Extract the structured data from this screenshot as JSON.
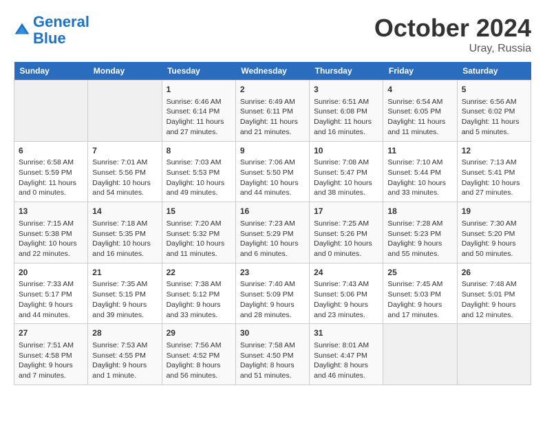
{
  "header": {
    "logo_line1": "General",
    "logo_line2": "Blue",
    "month": "October 2024",
    "location": "Uray, Russia"
  },
  "weekdays": [
    "Sunday",
    "Monday",
    "Tuesday",
    "Wednesday",
    "Thursday",
    "Friday",
    "Saturday"
  ],
  "weeks": [
    [
      {
        "day": "",
        "info": ""
      },
      {
        "day": "",
        "info": ""
      },
      {
        "day": "1",
        "info": "Sunrise: 6:46 AM\nSunset: 6:14 PM\nDaylight: 11 hours and 27 minutes."
      },
      {
        "day": "2",
        "info": "Sunrise: 6:49 AM\nSunset: 6:11 PM\nDaylight: 11 hours and 21 minutes."
      },
      {
        "day": "3",
        "info": "Sunrise: 6:51 AM\nSunset: 6:08 PM\nDaylight: 11 hours and 16 minutes."
      },
      {
        "day": "4",
        "info": "Sunrise: 6:54 AM\nSunset: 6:05 PM\nDaylight: 11 hours and 11 minutes."
      },
      {
        "day": "5",
        "info": "Sunrise: 6:56 AM\nSunset: 6:02 PM\nDaylight: 11 hours and 5 minutes."
      }
    ],
    [
      {
        "day": "6",
        "info": "Sunrise: 6:58 AM\nSunset: 5:59 PM\nDaylight: 11 hours and 0 minutes."
      },
      {
        "day": "7",
        "info": "Sunrise: 7:01 AM\nSunset: 5:56 PM\nDaylight: 10 hours and 54 minutes."
      },
      {
        "day": "8",
        "info": "Sunrise: 7:03 AM\nSunset: 5:53 PM\nDaylight: 10 hours and 49 minutes."
      },
      {
        "day": "9",
        "info": "Sunrise: 7:06 AM\nSunset: 5:50 PM\nDaylight: 10 hours and 44 minutes."
      },
      {
        "day": "10",
        "info": "Sunrise: 7:08 AM\nSunset: 5:47 PM\nDaylight: 10 hours and 38 minutes."
      },
      {
        "day": "11",
        "info": "Sunrise: 7:10 AM\nSunset: 5:44 PM\nDaylight: 10 hours and 33 minutes."
      },
      {
        "day": "12",
        "info": "Sunrise: 7:13 AM\nSunset: 5:41 PM\nDaylight: 10 hours and 27 minutes."
      }
    ],
    [
      {
        "day": "13",
        "info": "Sunrise: 7:15 AM\nSunset: 5:38 PM\nDaylight: 10 hours and 22 minutes."
      },
      {
        "day": "14",
        "info": "Sunrise: 7:18 AM\nSunset: 5:35 PM\nDaylight: 10 hours and 16 minutes."
      },
      {
        "day": "15",
        "info": "Sunrise: 7:20 AM\nSunset: 5:32 PM\nDaylight: 10 hours and 11 minutes."
      },
      {
        "day": "16",
        "info": "Sunrise: 7:23 AM\nSunset: 5:29 PM\nDaylight: 10 hours and 6 minutes."
      },
      {
        "day": "17",
        "info": "Sunrise: 7:25 AM\nSunset: 5:26 PM\nDaylight: 10 hours and 0 minutes."
      },
      {
        "day": "18",
        "info": "Sunrise: 7:28 AM\nSunset: 5:23 PM\nDaylight: 9 hours and 55 minutes."
      },
      {
        "day": "19",
        "info": "Sunrise: 7:30 AM\nSunset: 5:20 PM\nDaylight: 9 hours and 50 minutes."
      }
    ],
    [
      {
        "day": "20",
        "info": "Sunrise: 7:33 AM\nSunset: 5:17 PM\nDaylight: 9 hours and 44 minutes."
      },
      {
        "day": "21",
        "info": "Sunrise: 7:35 AM\nSunset: 5:15 PM\nDaylight: 9 hours and 39 minutes."
      },
      {
        "day": "22",
        "info": "Sunrise: 7:38 AM\nSunset: 5:12 PM\nDaylight: 9 hours and 33 minutes."
      },
      {
        "day": "23",
        "info": "Sunrise: 7:40 AM\nSunset: 5:09 PM\nDaylight: 9 hours and 28 minutes."
      },
      {
        "day": "24",
        "info": "Sunrise: 7:43 AM\nSunset: 5:06 PM\nDaylight: 9 hours and 23 minutes."
      },
      {
        "day": "25",
        "info": "Sunrise: 7:45 AM\nSunset: 5:03 PM\nDaylight: 9 hours and 17 minutes."
      },
      {
        "day": "26",
        "info": "Sunrise: 7:48 AM\nSunset: 5:01 PM\nDaylight: 9 hours and 12 minutes."
      }
    ],
    [
      {
        "day": "27",
        "info": "Sunrise: 7:51 AM\nSunset: 4:58 PM\nDaylight: 9 hours and 7 minutes."
      },
      {
        "day": "28",
        "info": "Sunrise: 7:53 AM\nSunset: 4:55 PM\nDaylight: 9 hours and 1 minute."
      },
      {
        "day": "29",
        "info": "Sunrise: 7:56 AM\nSunset: 4:52 PM\nDaylight: 8 hours and 56 minutes."
      },
      {
        "day": "30",
        "info": "Sunrise: 7:58 AM\nSunset: 4:50 PM\nDaylight: 8 hours and 51 minutes."
      },
      {
        "day": "31",
        "info": "Sunrise: 8:01 AM\nSunset: 4:47 PM\nDaylight: 8 hours and 46 minutes."
      },
      {
        "day": "",
        "info": ""
      },
      {
        "day": "",
        "info": ""
      }
    ]
  ]
}
